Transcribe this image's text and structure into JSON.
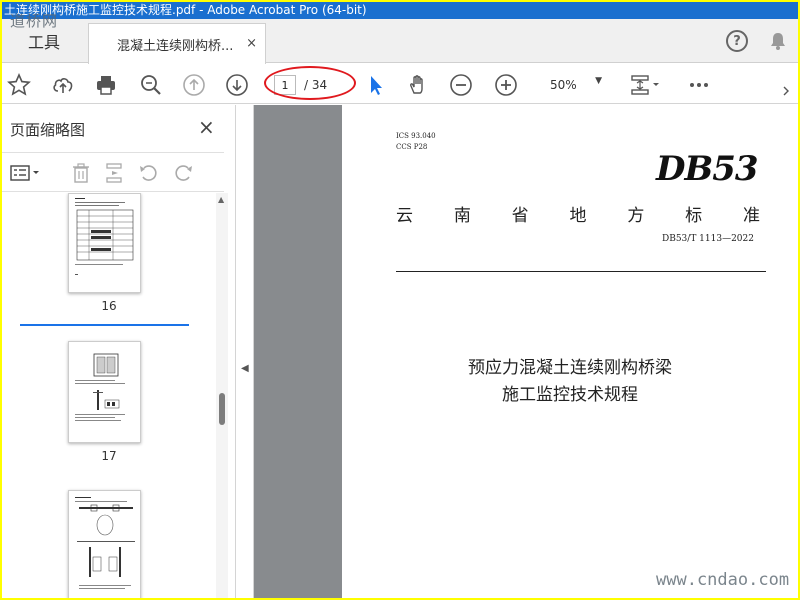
{
  "window": {
    "title": "土连续刚构桥施工监控技术规程.pdf - Adobe Acrobat Pro (64-bit)",
    "watermark_logo": "道桥网"
  },
  "tabs": {
    "tools_label": "工具",
    "doc_label": "混凝土连续刚构桥...",
    "close_glyph": "×"
  },
  "toolbar": {
    "current_page": "1",
    "total_pages": "/ 34",
    "zoom": "50%",
    "icons": [
      "star-icon",
      "cloud-upload-icon",
      "print-icon",
      "search-zoom-icon",
      "page-up-icon",
      "page-down-icon",
      "select-arrow-icon",
      "hand-icon",
      "zoom-out-icon",
      "zoom-in-icon",
      "page-layout-icon",
      "more-icon"
    ]
  },
  "sidebar": {
    "title": "页面缩略图",
    "close_glyph": "×",
    "thumbnails": [
      {
        "page": "16"
      },
      {
        "page": "17"
      },
      {
        "page": ""
      }
    ]
  },
  "document": {
    "ics": "ICS 93.040",
    "ccs": "CCS P28",
    "logo": "DB53",
    "standard_name_chars": [
      "云",
      "南",
      "省",
      "地",
      "方",
      "标",
      "准"
    ],
    "code": "DB53/T 1113—2022",
    "title_line1": "预应力混凝土连续刚构桥梁",
    "title_line2": "施工监控技术规程"
  },
  "site_watermark": "www.cndao.com",
  "colors": {
    "titlebar": "#1a6fcf",
    "highlight_ellipse": "#e0191e",
    "doc_background": "#888b8e",
    "selection": "#1a73e8",
    "frame": "#ffff00"
  }
}
